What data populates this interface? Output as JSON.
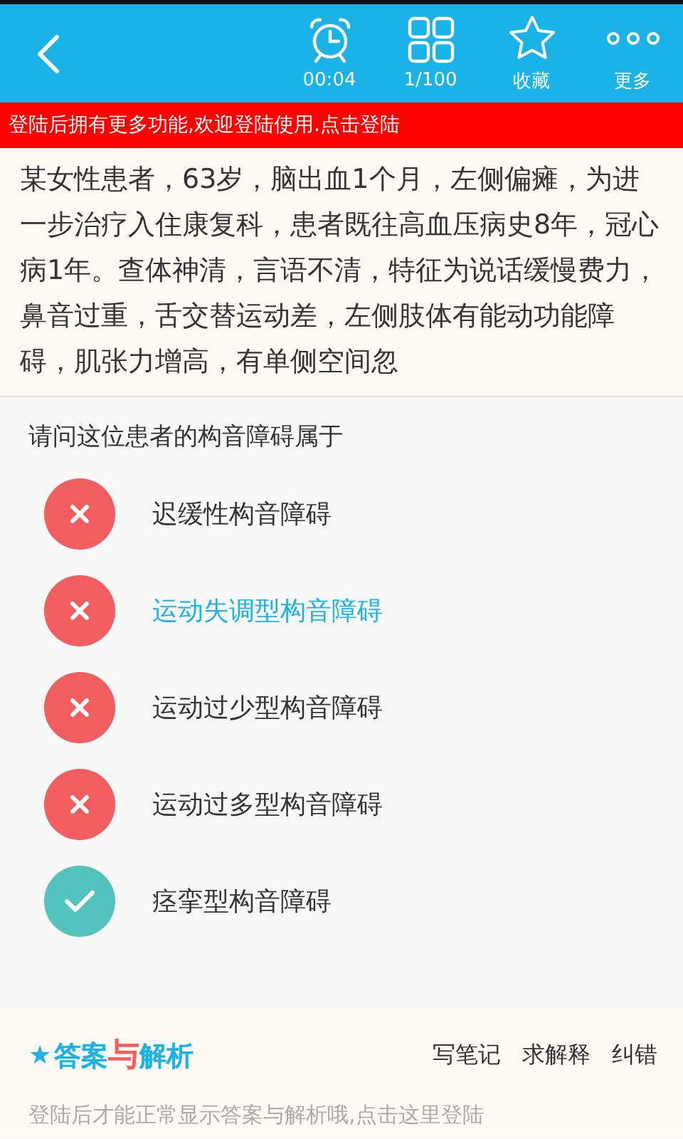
{
  "header": {
    "actions": [
      {
        "kind": "timer",
        "label": "00:04"
      },
      {
        "kind": "grid",
        "label": "1/100"
      },
      {
        "kind": "star",
        "label": "收藏"
      },
      {
        "kind": "more",
        "label": "更多"
      }
    ]
  },
  "login_banner": "登陆后拥有更多功能,欢迎登陆使用.点击登陆",
  "question": {
    "stem": "某女性患者，63岁，脑出血1个月，左侧偏瘫，为进一步治疗入住康复科，患者既往高血压病史8年，冠心病1年。查体神清，言语不清，特征为说话缓慢费力，鼻音过重，舌交替运动差，左侧肢体有能动功能障碍，肌张力增高，有单侧空间忽",
    "prompt": "请问这位患者的构音障碍属于",
    "options": [
      {
        "kind": "wrong",
        "label": "迟缓性构音障碍",
        "selected": false
      },
      {
        "kind": "wrong",
        "label": "运动失调型构音障碍",
        "selected": true
      },
      {
        "kind": "wrong",
        "label": "运动过少型构音障碍",
        "selected": false
      },
      {
        "kind": "wrong",
        "label": "运动过多型构音障碍",
        "selected": false
      },
      {
        "kind": "correct",
        "label": "痉挛型构音障碍",
        "selected": false
      }
    ]
  },
  "analysis": {
    "star": "★",
    "logo": [
      {
        "text": "答案",
        "accent": false
      },
      {
        "text": "与",
        "accent": true
      },
      {
        "text": "解析",
        "accent": false
      }
    ],
    "links": [
      "写笔记",
      "求解释",
      "纠错"
    ],
    "notice": "登陆后才能正常显示答案与解析哦,点击这里登陆"
  }
}
